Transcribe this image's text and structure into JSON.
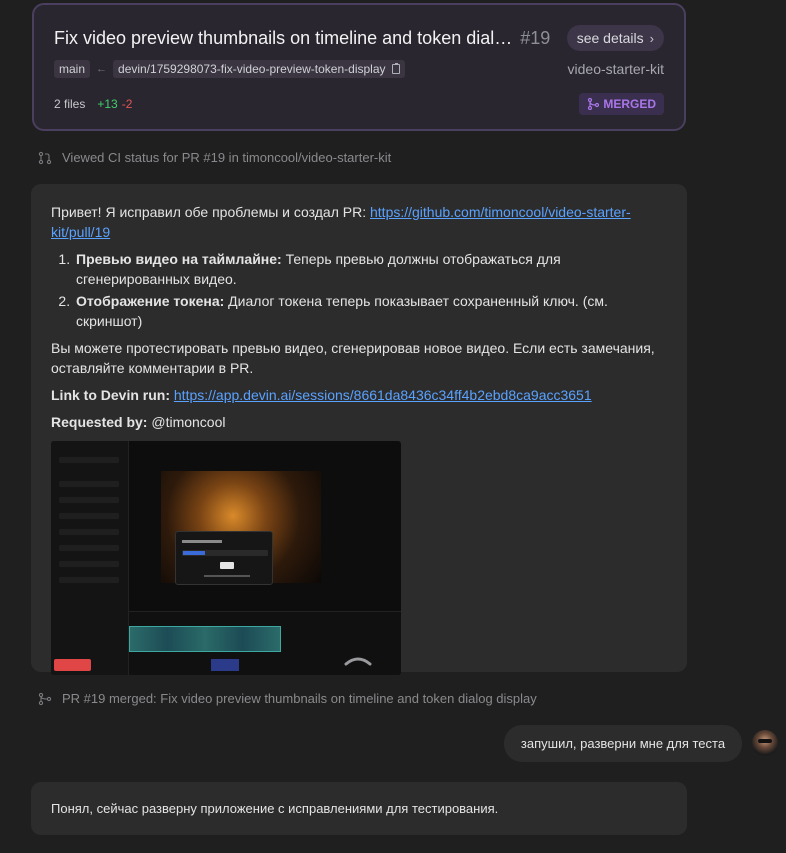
{
  "pr_card": {
    "title": "Fix video preview thumbnails on timeline and token dial…",
    "number": "#19",
    "see_details": "see details",
    "base_branch": "main",
    "head_branch": "devin/1759298073-fix-video-preview-token-display",
    "repo": "video-starter-kit",
    "files": "2 files",
    "additions": "+13",
    "deletions": "-2",
    "status": "MERGED",
    "status_color": "#a976e8"
  },
  "activity_1": "Viewed CI status for PR #19 in timoncool/video-starter-kit",
  "message": {
    "intro": "Привет! Я исправил обе проблемы и создал PR: ",
    "pr_link": "https://github.com/timoncool/video-starter-kit/pull/19",
    "items": [
      {
        "label": "Превью видео на таймлайне:",
        "text": " Теперь превью должны отображаться для сгенерированных видео."
      },
      {
        "label": "Отображение токена:",
        "text": " Диалог токена теперь показывает сохраненный ключ. (см. скриншот)"
      }
    ],
    "test_note": "Вы можете протестировать превью видео, сгенерировав новое видео. Если есть замечания, оставляйте комментарии в PR.",
    "run_label": "Link to Devin run:",
    "run_link": "https://app.devin.ai/sessions/8661da8436c34ff4b2ebd8ca9acc3651",
    "requested_label": "Requested by:",
    "requested_user": "@timoncool"
  },
  "activity_2": "PR #19 merged: Fix video preview thumbnails on timeline and token dialog display",
  "user_message": "запушил, разверни мне для теста",
  "reply": "Понял, сейчас разверну приложение с исправлениями для тестирования."
}
